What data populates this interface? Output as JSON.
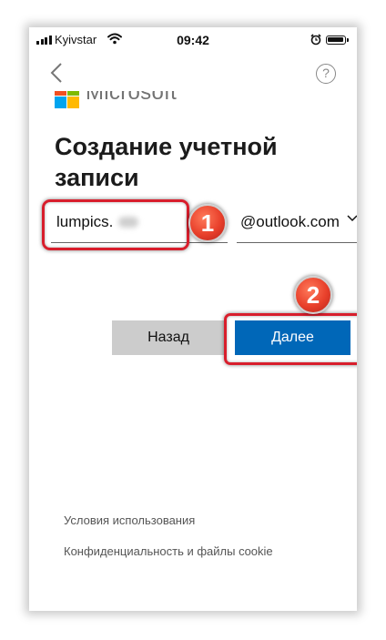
{
  "status_bar": {
    "carrier": "Kyivstar",
    "time": "09:42",
    "icons": [
      "signal-icon",
      "wifi-icon",
      "alarm-icon",
      "battery-icon"
    ]
  },
  "nav": {
    "back_icon": "chevron-left-icon",
    "help_label": "?"
  },
  "brand": {
    "name": "Microsoft",
    "logo_colors": [
      "#f25022",
      "#7fba00",
      "#00a4ef",
      "#ffb900"
    ]
  },
  "page_title": "Создание учетной записи",
  "form": {
    "username_value": "lumpics.",
    "domain_value": "@outlook.com"
  },
  "buttons": {
    "back_label": "Назад",
    "next_label": "Далее"
  },
  "annotations": {
    "step1": "1",
    "step2": "2",
    "highlight_color": "#d81e2c"
  },
  "footer": {
    "terms_label": "Условия использования",
    "privacy_label": "Конфиденциальность и файлы cookie"
  },
  "colors": {
    "primary_button": "#0067b8",
    "secondary_button": "#cccccc"
  }
}
